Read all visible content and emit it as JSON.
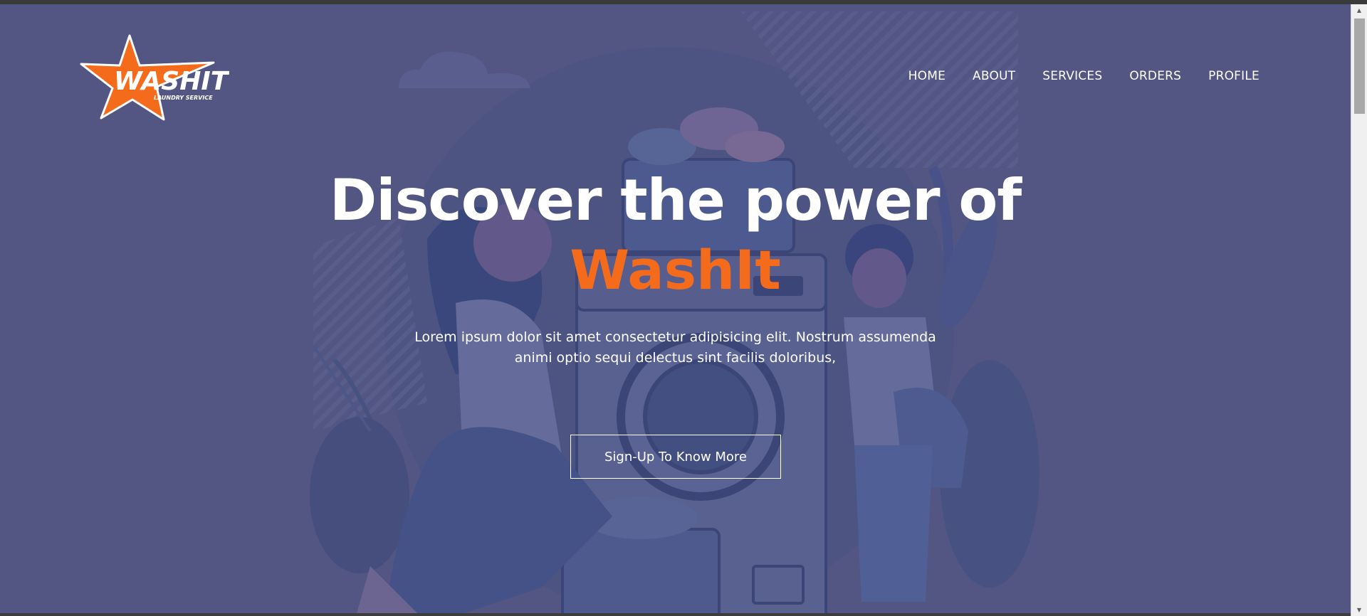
{
  "header": {
    "logo": {
      "wordmark": "WASHIT",
      "tagline": "LAUNDRY SERVICE"
    },
    "nav": [
      {
        "label": "HOME"
      },
      {
        "label": "ABOUT"
      },
      {
        "label": "SERVICES"
      },
      {
        "label": "ORDERS"
      },
      {
        "label": "PROFILE"
      }
    ]
  },
  "hero": {
    "title": "Discover the power of",
    "brand": "WashIt",
    "description": "Lorem ipsum dolor sit amet consectetur adipisicing elit. Nostrum assumenda animi optio sequi delectus sint facilis doloribus,",
    "cta_label": "Sign-Up To Know More"
  },
  "colors": {
    "background": "#535783",
    "accent": "#f56b1c",
    "text": "#ffffff"
  },
  "icons": {
    "scroll_up": "scroll-up-arrow-icon",
    "scroll_down": "scroll-down-arrow-icon"
  }
}
